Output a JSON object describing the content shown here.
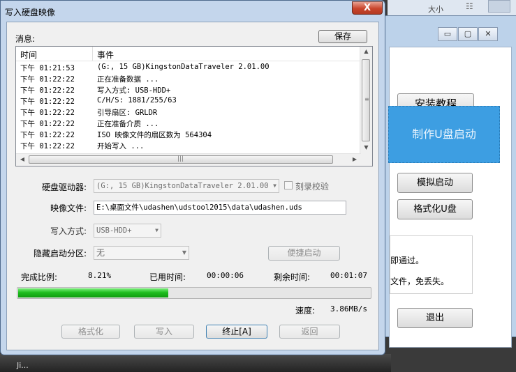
{
  "background": {
    "column_header": "大小",
    "bg_window": {
      "install_tutorial": "安装教程",
      "make_usb_boot": "制作U盘启动",
      "simulate_boot": "模拟启动",
      "format_usb": "格式化U盘",
      "info_line1": "即通过。",
      "info_line2": "文件，免丢失。",
      "exit": "退出"
    },
    "desktop_text": "Ji..."
  },
  "dialog": {
    "title": "写入硬盘映像",
    "close_glyph": "X",
    "messages_label": "消息:",
    "save_button": "保存",
    "log": {
      "columns": [
        "时间",
        "事件"
      ],
      "rows": [
        {
          "time": "下午 01:21:53",
          "event": "(G:, 15 GB)KingstonDataTraveler 2.01.00"
        },
        {
          "time": "下午 01:22:22",
          "event": "正在准备数据 ..."
        },
        {
          "time": "下午 01:22:22",
          "event": "写入方式: USB-HDD+"
        },
        {
          "time": "下午 01:22:22",
          "event": "C/H/S: 1881/255/63"
        },
        {
          "time": "下午 01:22:22",
          "event": "引导扇区: GRLDR"
        },
        {
          "time": "下午 01:22:22",
          "event": "正在准备介质 ..."
        },
        {
          "time": "下午 01:22:22",
          "event": "ISO 映像文件的扇区数为 564304"
        },
        {
          "time": "下午 01:22:22",
          "event": "开始写入 ..."
        }
      ]
    },
    "drive_label": "硬盘驱动器:",
    "drive_value": "(G:, 15 GB)KingstonDataTraveler 2.01.00",
    "verify_label": "刻录校验",
    "image_label": "映像文件:",
    "image_value": "E:\\桌面文件\\udashen\\udstool2015\\data\\udashen.uds",
    "write_mode_label": "写入方式:",
    "write_mode_value": "USB-HDD+",
    "hidden_partition_label": "隐藏启动分区:",
    "hidden_partition_value": "无",
    "quick_boot_button": "便捷启动",
    "progress_label": "完成比例:",
    "progress_value": "8.21%",
    "progress_fraction": 0.0821,
    "elapsed_label": "已用时间:",
    "elapsed_value": "00:00:06",
    "remaining_label": "剩余时间:",
    "remaining_value": "00:01:07",
    "speed_label": "速度:",
    "speed_value": "3.86MB/s",
    "buttons": {
      "format": "格式化",
      "write": "写入",
      "abort": "终止[A]",
      "back": "返回"
    }
  },
  "colors": {
    "progress_fill": "#1fbd1f",
    "close_button": "#c9452c",
    "dialog_frame": "#c4d6ec",
    "make_usb_tile": "#3d9ee2"
  }
}
